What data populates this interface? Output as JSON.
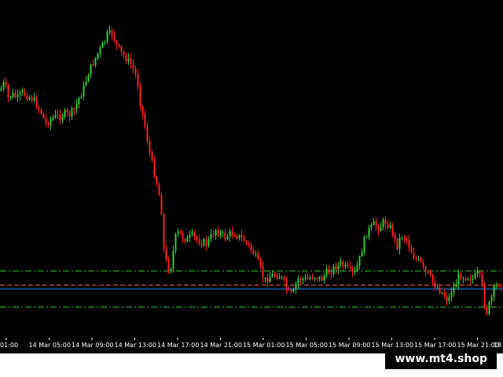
{
  "chart_data": {
    "type": "candlestick",
    "x_tick_labels": [
      "01:00",
      "14 Mar 05:00",
      "14 Mar 09:00",
      "14 Mar 13:00",
      "14 Mar 17:00",
      "14 Mar 21:00",
      "15 Mar 01:00",
      "15 Mar 05:00",
      "15 Mar 09:00",
      "15 Mar 13:00",
      "15 Mar 17:00",
      "15 Mar 21:00",
      "18"
    ],
    "ylim": [
      0,
      430
    ],
    "close_path": [
      [
        0,
        115
      ],
      [
        5,
        105
      ],
      [
        10,
        125
      ],
      [
        15,
        120
      ],
      [
        22,
        125
      ],
      [
        28,
        118
      ],
      [
        34,
        122
      ],
      [
        40,
        125
      ],
      [
        46,
        133
      ],
      [
        52,
        143
      ],
      [
        58,
        158
      ],
      [
        64,
        152
      ],
      [
        70,
        148
      ],
      [
        76,
        148
      ],
      [
        82,
        145
      ],
      [
        88,
        146
      ],
      [
        94,
        140
      ],
      [
        100,
        125
      ],
      [
        106,
        112
      ],
      [
        112,
        92
      ],
      [
        118,
        80
      ],
      [
        124,
        68
      ],
      [
        130,
        58
      ],
      [
        136,
        45
      ],
      [
        142,
        42
      ],
      [
        148,
        58
      ],
      [
        154,
        68
      ],
      [
        160,
        74
      ],
      [
        166,
        82
      ],
      [
        170,
        90
      ],
      [
        174,
        100
      ],
      [
        178,
        130
      ],
      [
        182,
        150
      ],
      [
        186,
        172
      ],
      [
        190,
        195
      ],
      [
        194,
        212
      ],
      [
        198,
        228
      ],
      [
        202,
        248
      ],
      [
        206,
        275
      ],
      [
        208,
        318
      ],
      [
        212,
        338
      ],
      [
        216,
        345
      ],
      [
        220,
        320
      ],
      [
        224,
        296
      ],
      [
        228,
        298
      ],
      [
        232,
        302
      ],
      [
        238,
        305
      ],
      [
        244,
        300
      ],
      [
        250,
        305
      ],
      [
        256,
        308
      ],
      [
        262,
        310
      ],
      [
        268,
        302
      ],
      [
        274,
        292
      ],
      [
        280,
        298
      ],
      [
        286,
        302
      ],
      [
        292,
        298
      ],
      [
        298,
        297
      ],
      [
        304,
        302
      ],
      [
        310,
        306
      ],
      [
        316,
        313
      ],
      [
        322,
        322
      ],
      [
        326,
        330
      ],
      [
        330,
        340
      ],
      [
        336,
        358
      ],
      [
        342,
        352
      ],
      [
        348,
        350
      ],
      [
        354,
        350
      ],
      [
        360,
        358
      ],
      [
        366,
        372
      ],
      [
        372,
        376
      ],
      [
        378,
        355
      ],
      [
        384,
        355
      ],
      [
        390,
        356
      ],
      [
        396,
        352
      ],
      [
        402,
        352
      ],
      [
        408,
        356
      ],
      [
        414,
        348
      ],
      [
        420,
        345
      ],
      [
        426,
        340
      ],
      [
        432,
        336
      ],
      [
        438,
        340
      ],
      [
        444,
        345
      ],
      [
        450,
        350
      ],
      [
        456,
        334
      ],
      [
        462,
        310
      ],
      [
        466,
        296
      ],
      [
        470,
        292
      ],
      [
        476,
        285
      ],
      [
        482,
        290
      ],
      [
        488,
        282
      ],
      [
        494,
        286
      ],
      [
        500,
        298
      ],
      [
        504,
        315
      ],
      [
        510,
        300
      ],
      [
        516,
        302
      ],
      [
        522,
        318
      ],
      [
        528,
        330
      ],
      [
        534,
        333
      ],
      [
        540,
        348
      ],
      [
        546,
        352
      ],
      [
        552,
        362
      ],
      [
        558,
        368
      ],
      [
        564,
        375
      ],
      [
        570,
        383
      ],
      [
        574,
        370
      ],
      [
        578,
        365
      ],
      [
        584,
        350
      ],
      [
        590,
        352
      ],
      [
        596,
        352
      ],
      [
        602,
        355
      ],
      [
        608,
        348
      ],
      [
        612,
        360
      ],
      [
        618,
        400
      ],
      [
        624,
        382
      ],
      [
        628,
        368
      ],
      [
        634,
        360
      ]
    ],
    "horizontal_lines": [
      {
        "value": 345,
        "color": "#32cd32",
        "style": "dash-dot"
      },
      {
        "value": 363,
        "color": "#ff6347",
        "style": "dashed"
      },
      {
        "value": 368,
        "color": "#1e90ff",
        "style": "solid"
      },
      {
        "value": 391,
        "color": "#32cd32",
        "style": "dash-dot"
      }
    ],
    "colors": {
      "bull": "#32cd32",
      "bear": "#ff2020",
      "background": "#000000",
      "tick_text": "#ffffff"
    }
  },
  "watermark": {
    "text": "www.mt4.shop"
  }
}
